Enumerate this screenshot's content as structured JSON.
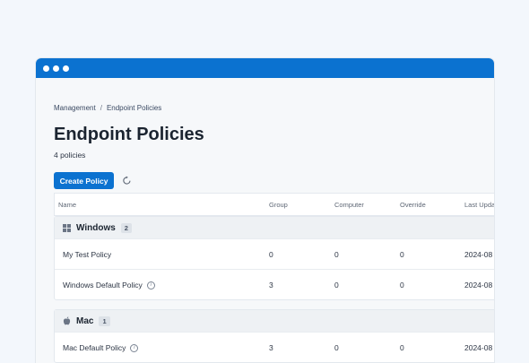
{
  "breadcrumb": {
    "parent": "Management",
    "separator": "/",
    "current": "Endpoint Policies"
  },
  "page": {
    "title": "Endpoint Policies",
    "count": "4 policies"
  },
  "toolbar": {
    "create_label": "Create Policy"
  },
  "table": {
    "columns": {
      "name": "Name",
      "group": "Group",
      "computer": "Computer",
      "override": "Override",
      "updated": "Last Upda"
    },
    "groups": [
      {
        "label": "Windows",
        "badge": "2",
        "icon": "windows-icon",
        "rows": [
          {
            "name": "My Test Policy",
            "group": "0",
            "computer": "0",
            "override": "0",
            "updated": "2024-08"
          },
          {
            "name": "Windows Default Policy",
            "group": "3",
            "computer": "0",
            "override": "0",
            "updated": "2024-08"
          }
        ]
      },
      {
        "label": "Mac",
        "badge": "1",
        "icon": "apple-icon",
        "rows": [
          {
            "name": "Mac Default Policy",
            "group": "3",
            "computer": "0",
            "override": "0",
            "updated": "2024-08"
          }
        ]
      }
    ]
  },
  "colors": {
    "accent": "#0b72d0",
    "background": "#f3f7fc"
  }
}
